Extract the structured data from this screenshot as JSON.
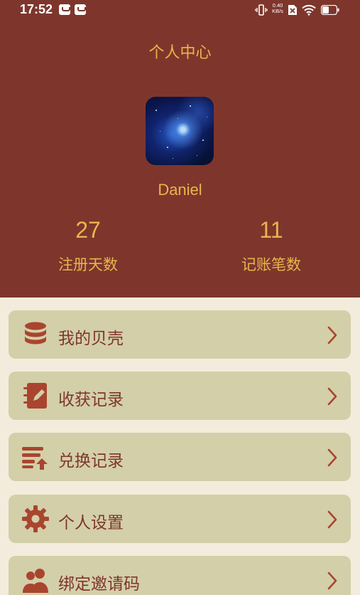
{
  "status_bar": {
    "time": "17:52",
    "net_speed_value": "0.40",
    "net_speed_unit": "KB/s",
    "icons": [
      "app-notification-icon",
      "app-notification-icon",
      "vibrate-icon",
      "no-sim-icon",
      "wifi-icon",
      "battery-icon"
    ]
  },
  "header": {
    "title": "个人中心",
    "avatar": "galaxy-avatar",
    "username": "Daniel",
    "stats": [
      {
        "value": "27",
        "label": "注册天数"
      },
      {
        "value": "11",
        "label": "记账笔数"
      }
    ]
  },
  "menu": {
    "items": [
      {
        "label": "我的贝壳",
        "icon": "database-coins-icon"
      },
      {
        "label": "收获记录",
        "icon": "notebook-edit-icon"
      },
      {
        "label": "兑换记录",
        "icon": "list-upload-icon"
      },
      {
        "label": "个人设置",
        "icon": "gear-icon"
      },
      {
        "label": "绑定邀请码",
        "icon": "user-group-icon"
      }
    ]
  },
  "colors": {
    "header_bg": "#7e362c",
    "accent_gold": "#e8b54e",
    "page_bg": "#f3ecdc",
    "card_bg": "#d3cfa9",
    "icon_brown": "#a9452f"
  }
}
